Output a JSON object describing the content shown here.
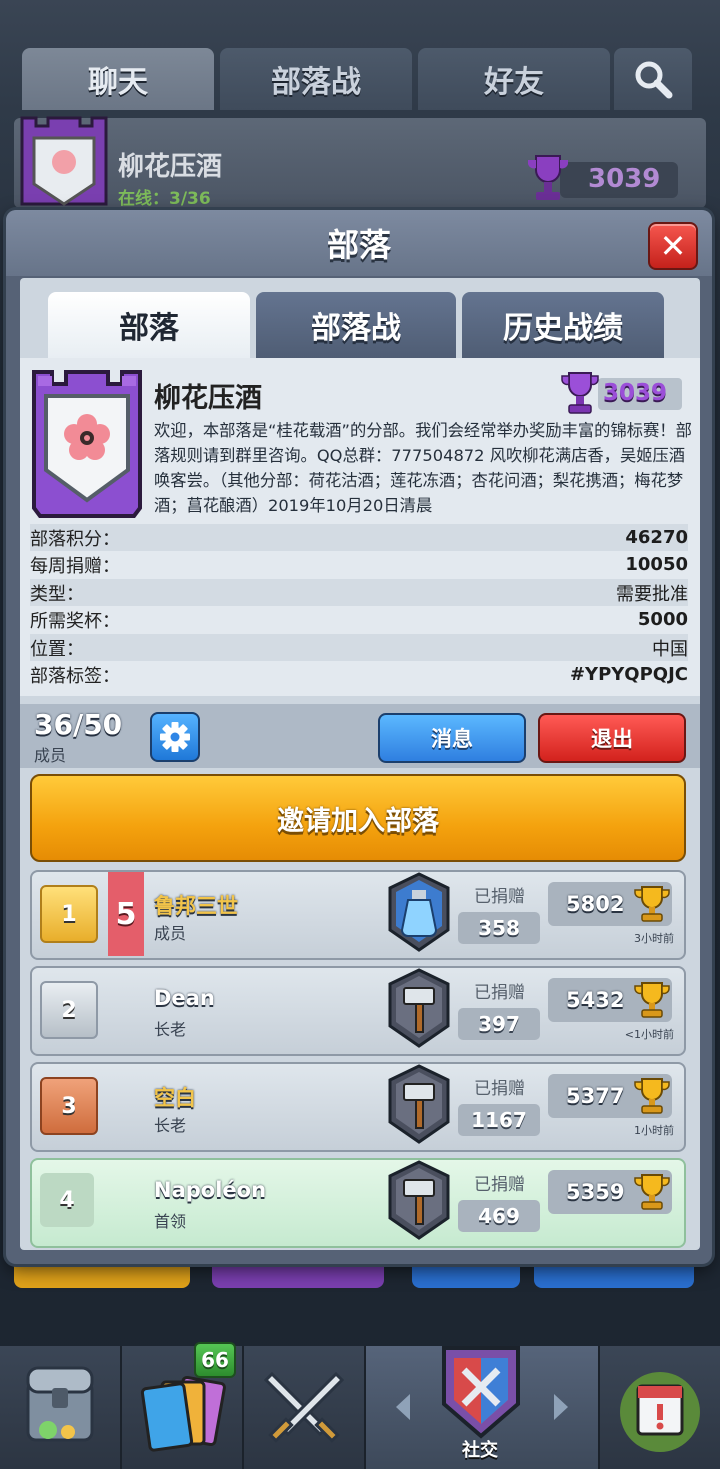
{
  "top_tabs": [
    "聊天",
    "部落战",
    "好友"
  ],
  "bg_clan": {
    "name": "柳花压酒",
    "online_label": "在线：",
    "online_value": "3/36",
    "trophies": "3039"
  },
  "modal": {
    "title": "部落",
    "close_symbol": "✕",
    "tabs": [
      "部落",
      "部落战",
      "历史战绩"
    ]
  },
  "clan": {
    "name": "柳花压酒",
    "trophies": "3039",
    "description": "欢迎，本部落是“桂花载酒”的分部。我们会经常举办奖励丰富的锦标赛！部落规则请到群里咨询。QQ总群：777504872 风吹柳花满店香，吴姬压酒唤客尝。（其他分部：荷花沽酒；莲花冻酒；杏花问酒；梨花携酒；梅花梦酒；菖花酿酒）2019年10月20日清晨",
    "stats": [
      {
        "label": "部落积分：",
        "value": "46270"
      },
      {
        "label": "每周捐赠：",
        "value": "10050"
      },
      {
        "label": "类型：",
        "value": "需要批准"
      },
      {
        "label": "所需奖杯：",
        "value": "5000"
      },
      {
        "label": "位置：",
        "value": "中国"
      },
      {
        "label": "部落标签：",
        "value": "#YPYQPQJC"
      }
    ]
  },
  "members_bar": {
    "count": "36/50",
    "label": "成员",
    "message_button": "消息",
    "leave_button": "退出"
  },
  "invite_button": "邀请加入部落",
  "members": [
    {
      "rank": "1",
      "level": "5",
      "name": "鲁邦三世",
      "role": "成员",
      "donated_label": "已捐赠",
      "donated": "358",
      "trophies": "5802",
      "last_seen": "3小时前",
      "name_color": "#f2c44a",
      "card": "potion"
    },
    {
      "rank": "2",
      "level": "",
      "name": "Dean",
      "role": "长老",
      "donated_label": "已捐赠",
      "donated": "397",
      "trophies": "5432",
      "last_seen": "<1小时前",
      "name_color": "#ffffff",
      "card": "hammer"
    },
    {
      "rank": "3",
      "level": "",
      "name": "空白",
      "role": "长老",
      "donated_label": "已捐赠",
      "donated": "1167",
      "trophies": "5377",
      "last_seen": "1小时前",
      "name_color": "#f2c44a",
      "card": "hammer"
    },
    {
      "rank": "4",
      "level": "",
      "name": "Napoléon",
      "role": "首领",
      "donated_label": "已捐赠",
      "donated": "469",
      "trophies": "5359",
      "last_seen": "",
      "name_color": "#ffffff",
      "card": "hammer"
    }
  ],
  "nav": {
    "badge_count": "66",
    "active_label": "社交"
  }
}
